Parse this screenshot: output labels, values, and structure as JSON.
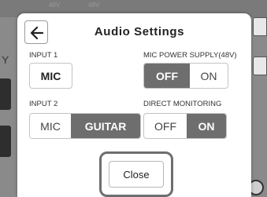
{
  "background": {
    "top_ticks": [
      "48V",
      "48V"
    ],
    "side_letter": "Y"
  },
  "dialog": {
    "title": "Audio Settings",
    "back_icon": "arrow-left-icon",
    "input1": {
      "label": "INPUT 1",
      "value": "MIC"
    },
    "mic_power": {
      "label": "MIC POWER SUPPLY(48V)",
      "options": [
        "OFF",
        "ON"
      ],
      "selected": "OFF"
    },
    "input2": {
      "label": "INPUT 2",
      "options": [
        "MIC",
        "GUITAR"
      ],
      "selected": "GUITAR"
    },
    "direct_monitoring": {
      "label": "DIRECT MONITORING",
      "options": [
        "OFF",
        "ON"
      ],
      "selected": "ON"
    },
    "close_label": "Close"
  },
  "colors": {
    "selected": "#6e6e6e",
    "overlay": "#8a8a8a"
  }
}
